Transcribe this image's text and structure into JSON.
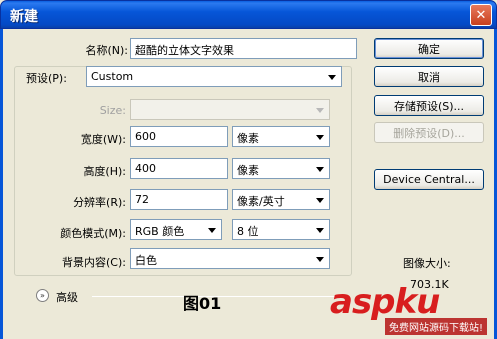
{
  "window": {
    "title": "新建",
    "close_symbol": "✕"
  },
  "form": {
    "name_label": "名称(N):",
    "name_value": "超酷的立体文字效果",
    "preset_label": "预设(P):",
    "preset_value": "Custom",
    "size_label": "Size:",
    "size_value": "",
    "width_label": "宽度(W):",
    "width_value": "600",
    "width_unit": "像素",
    "height_label": "高度(H):",
    "height_value": "400",
    "height_unit": "像素",
    "resolution_label": "分辨率(R):",
    "resolution_value": "72",
    "resolution_unit": "像素/英寸",
    "color_mode_label": "颜色模式(M):",
    "color_mode_value": "RGB 颜色",
    "bit_depth_value": "8 位",
    "background_label": "背景内容(C):",
    "background_value": "白色",
    "advanced_label": "高级"
  },
  "buttons": {
    "ok": "确定",
    "cancel": "取消",
    "save_preset": "存储预设(S)...",
    "delete_preset": "删除预设(D)...",
    "device_central": "Device Central..."
  },
  "image_size": {
    "label": "图像大小:",
    "value": "703.1K"
  },
  "overlay": {
    "figure_label": "图01",
    "watermark": "aspku",
    "watermark_sub": "免费网站源码下载站!"
  },
  "colors": {
    "titlebar": "#0656d8",
    "dialog_bg": "#ece9d8",
    "watermark": "#d81e1e"
  }
}
